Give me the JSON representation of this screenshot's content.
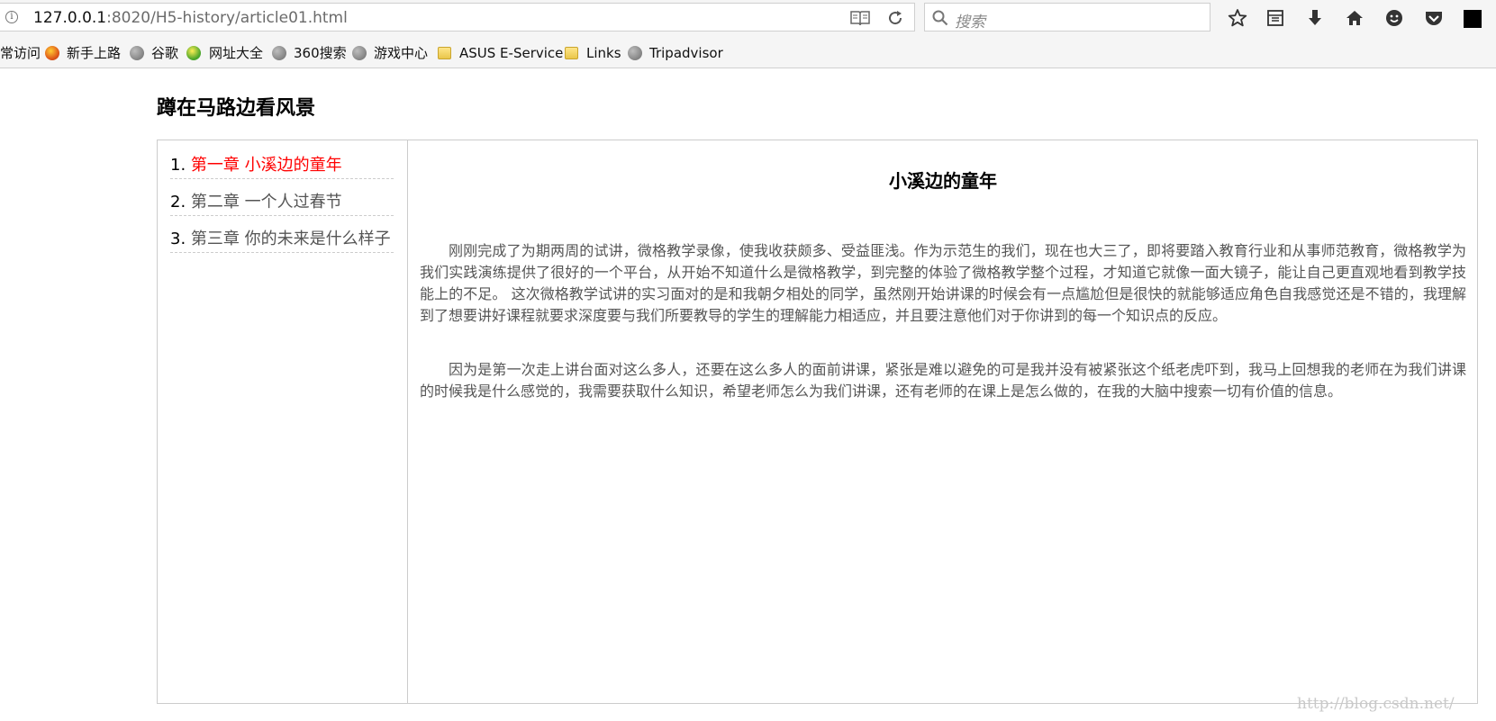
{
  "browser": {
    "url_host": "127.0.0.1",
    "url_path": ":8020/H5-history/article01.html",
    "search_placeholder": "搜索"
  },
  "bookmarks": [
    {
      "label": "常访问",
      "icon": "none"
    },
    {
      "label": "新手上路",
      "icon": "firefox-icon"
    },
    {
      "label": "谷歌",
      "icon": "globe-icon"
    },
    {
      "label": "网址大全",
      "icon": "hao-icon"
    },
    {
      "label": "360搜索",
      "icon": "globe-icon"
    },
    {
      "label": "游戏中心",
      "icon": "globe-icon"
    },
    {
      "label": "ASUS E-Service",
      "icon": "folder-icon"
    },
    {
      "label": "Links",
      "icon": "folder-icon"
    },
    {
      "label": "Tripadvisor",
      "icon": "globe-icon"
    }
  ],
  "page": {
    "site_title": "蹲在马路边看风景",
    "chapters": [
      {
        "num": "1.",
        "label": "第一章 小溪边的童年",
        "active": true
      },
      {
        "num": "2.",
        "label": "第二章 一个人过春节",
        "active": false
      },
      {
        "num": "3.",
        "label": "第三章 你的未来是什么样子",
        "active": false
      }
    ],
    "article_title": "小溪边的童年",
    "paragraphs": [
      "刚刚完成了为期两周的试讲，微格教学录像，使我收获颇多、受益匪浅。作为示范生的我们，现在也大三了，即将要踏入教育行业和从事师范教育，微格教学为我们实践演练提供了很好的一个平台，从开始不知道什么是微格教学，到完整的体验了微格教学整个过程，才知道它就像一面大镜子，能让自己更直观地看到教学技能上的不足。 这次微格教学试讲的实习面对的是和我朝夕相处的同学，虽然刚开始讲课的时候会有一点尴尬但是很快的就能够适应角色自我感觉还是不错的，我理解到了想要讲好课程就要求深度要与我们所要教导的学生的理解能力相适应，并且要注意他们对于你讲到的每一个知识点的反应。",
      "因为是第一次走上讲台面对这么多人，还要在这么多人的面前讲课，紧张是难以避免的可是我并没有被紧张这个纸老虎吓到，我马上回想我的老师在为我们讲课的时候我是什么感觉的，我需要获取什么知识，希望老师怎么为我们讲课，还有老师的在课上是怎么做的，在我的大脑中搜索一切有价值的信息。"
    ]
  },
  "watermark": "http://blog.csdn.net/"
}
